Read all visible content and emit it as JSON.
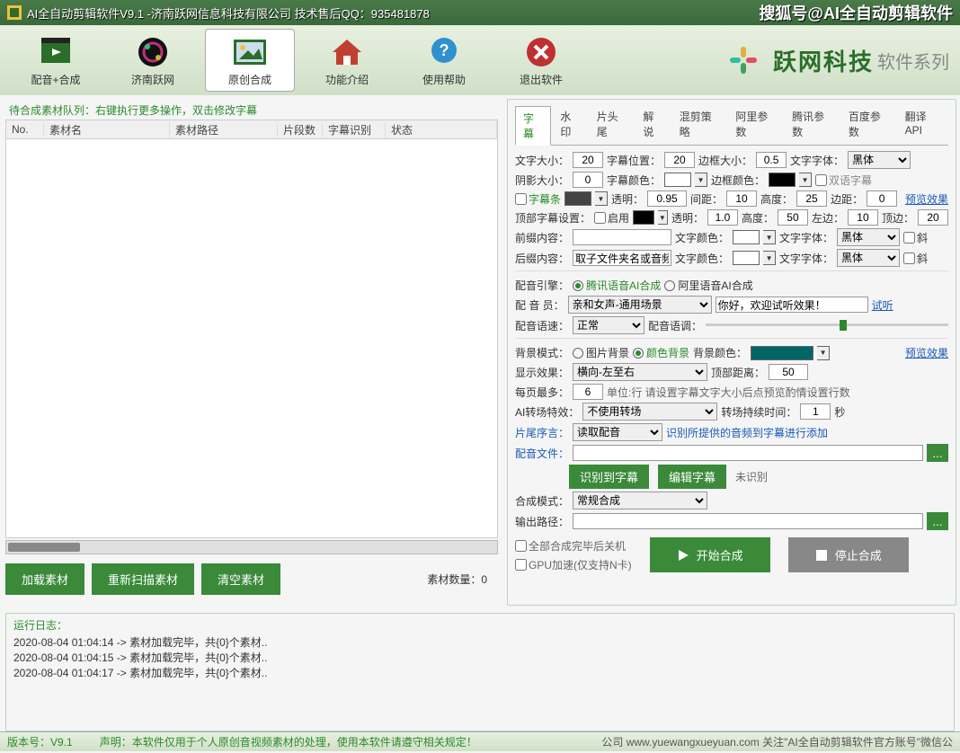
{
  "title_bar": {
    "app_title": "AI全自动剪辑软件V9.1 -济南跃网信息科技有限公司 技术售后QQ：935481878",
    "branding": "搜狐号@AI全自动剪辑软件"
  },
  "toolbar": {
    "items": [
      {
        "label": "配音+合成"
      },
      {
        "label": "济南跃网"
      },
      {
        "label": "原创合成"
      },
      {
        "label": "功能介绍"
      },
      {
        "label": "使用帮助"
      },
      {
        "label": "退出软件"
      }
    ],
    "logo_text": "跃网科技",
    "logo_sub": "软件系列"
  },
  "queue": {
    "hint": "待合成素材队列：右键执行更多操作，双击修改字幕",
    "headers": {
      "no": "No.",
      "name": "素材名",
      "path": "素材路径",
      "seg": "片段数",
      "recog": "字幕识别",
      "status": "状态"
    },
    "actions": {
      "load": "加载素材",
      "rescan": "重新扫描素材",
      "clear": "清空素材"
    },
    "count_label": "素材数量：0"
  },
  "tabs": [
    "字幕",
    "水印",
    "片头尾",
    "解说",
    "混剪策略",
    "阿里参数",
    "腾讯参数",
    "百度参数",
    "翻译API"
  ],
  "subtitle": {
    "r1": {
      "font_size_l": "文字大小：",
      "font_size": "20",
      "pos_l": "字幕位置：",
      "pos": "20",
      "border_l": "边框大小：",
      "border": "0.5",
      "font_l": "文字字体：",
      "font": "黑体"
    },
    "r2": {
      "shadow_l": "阴影大小：",
      "shadow": "0",
      "sub_color_l": "字幕颜色：",
      "border_color_l": "边框颜色：",
      "dual": "双语字幕"
    },
    "r3": {
      "bar_chk": "字幕条",
      "opacity_l": "透明：",
      "opacity": "0.95",
      "gap_l": "间距：",
      "gap": "10",
      "height_l": "高度：",
      "height": "25",
      "margin_l": "边距：",
      "margin": "0",
      "preview": "预览效果"
    },
    "r4": {
      "top_l": "顶部字幕设置：",
      "enable": "启用",
      "opacity_l": "透明：",
      "opacity": "1.0",
      "height_l": "高度：",
      "height": "50",
      "left_l": "左边：",
      "left": "10",
      "top_m_l": "顶边：",
      "top_m": "20"
    },
    "r5": {
      "prefix_l": "前缀内容：",
      "prefix": "",
      "color_l": "文字颜色：",
      "font_l": "文字字体：",
      "font": "黑体",
      "italic": "斜"
    },
    "r6": {
      "suffix_l": "后缀内容：",
      "suffix": "取子文件夹名或音频",
      "color_l": "文字颜色：",
      "font_l": "文字字体：",
      "font": "黑体",
      "italic": "斜"
    }
  },
  "voice": {
    "engine_l": "配音引擎：",
    "engine_a": "腾讯语音AI合成",
    "engine_b": "阿里语音AI合成",
    "member_l": "配 音 员：",
    "member": "亲和女声-通用场景",
    "sample": "你好，欢迎试听效果！",
    "try": "试听",
    "speed_l": "配音语速：",
    "speed": "正常",
    "tone_l": "配音语调："
  },
  "bg": {
    "mode_l": "背景模式：",
    "mode_a": "图片背景",
    "mode_b": "颜色背景",
    "color_l": "背景颜色：",
    "preview": "预览效果",
    "show_l": "显示效果：",
    "show": "横向-左至右",
    "top_dist_l": "顶部距离：",
    "top_dist": "50",
    "max_l": "每页最多：",
    "max": "6",
    "max_hint": "单位:行 请设置字幕文字大小后点预览酌情设置行数",
    "trans_l": "AI转场特效：",
    "trans": "不使用转场",
    "dur_l": "转场持续时间：",
    "dur": "1",
    "dur_unit": "秒",
    "tail_l": "片尾序言：",
    "tail": "读取配音",
    "tail_hint": "识别所提供的音频到字幕进行添加",
    "audio_l": "配音文件：",
    "btn_recog": "识别到字幕",
    "btn_edit": "编辑字幕",
    "unrecog": "未识别",
    "compose_l": "合成模式：",
    "compose": "常规合成",
    "out_l": "输出路径："
  },
  "bottom": {
    "chk_shutdown": "全部合成完毕后关机",
    "chk_gpu": "GPU加速(仅支持N卡)",
    "start": "开始合成",
    "stop": "停止合成"
  },
  "log": {
    "title": "运行日志：",
    "lines": [
      "2020-08-04 01:04:14 -> 素材加载完毕，共{0}个素材..",
      "2020-08-04 01:04:15 -> 素材加载完毕，共{0}个素材..",
      "2020-08-04 01:04:17 -> 素材加载完毕，共{0}个素材.."
    ]
  },
  "status": {
    "ver_l": "版本号：V9.1",
    "decl": "声明：本软件仅用于个人原创音视频素材的处理，使用本软件请遵守相关规定！",
    "right": "公司 www.yuewangxueyuan.com 关注\"AI全自动剪辑软件官方账号\"微信公"
  }
}
